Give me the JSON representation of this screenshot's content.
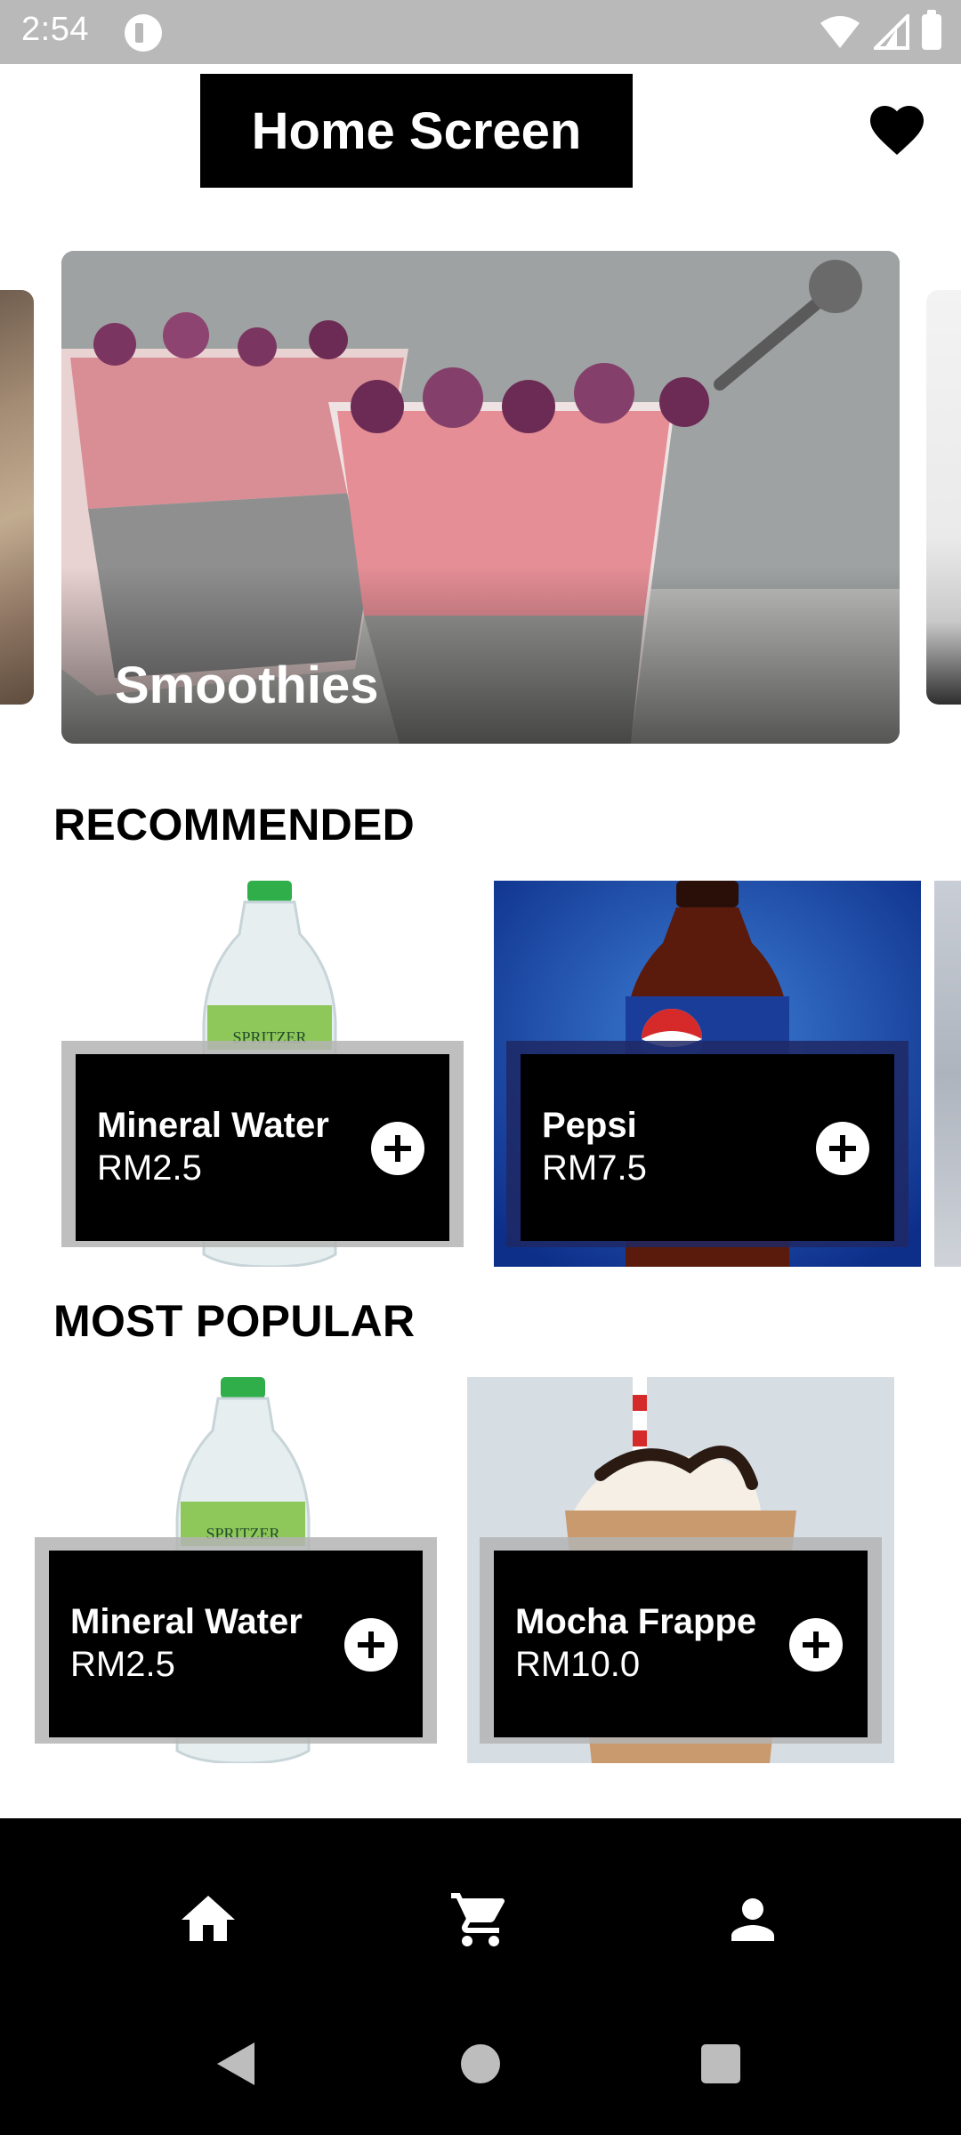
{
  "status_bar": {
    "time": "2:54"
  },
  "header": {
    "title": "Home Screen"
  },
  "hero": {
    "title": "Smoothies"
  },
  "sections": {
    "recommended": {
      "title": "RECOMMENDED",
      "items": [
        {
          "name": "Mineral Water",
          "price": "RM2.5"
        },
        {
          "name": "Pepsi",
          "price": "RM7.5"
        }
      ]
    },
    "most_popular": {
      "title": "MOST POPULAR",
      "items": [
        {
          "name": "Mineral Water",
          "price": "RM2.5"
        },
        {
          "name": "Mocha Frappe",
          "price": "RM10.0"
        }
      ]
    }
  },
  "product_brand_text": "SPRITZER",
  "bottom_nav": {
    "items": [
      {
        "icon": "home-icon"
      },
      {
        "icon": "cart-icon"
      },
      {
        "icon": "person-icon"
      }
    ]
  },
  "colors": {
    "accent": "#000000",
    "status_bar": "#b9b9b9"
  }
}
